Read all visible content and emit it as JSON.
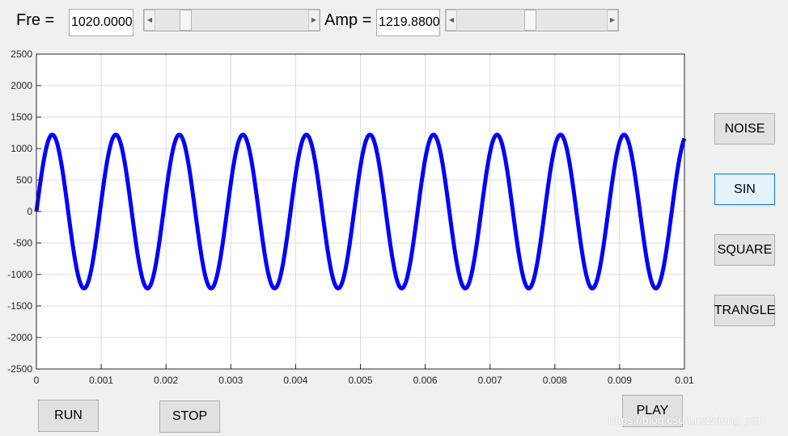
{
  "controls": {
    "fre_label": "Fre =",
    "fre_value": "1020.0000",
    "fre_slider_fraction": 0.17,
    "amp_label": "Amp =",
    "amp_value": "1219.8800",
    "amp_slider_fraction": 0.49
  },
  "buttons": {
    "noise": "NOISE",
    "sin": "SIN",
    "square": "SQUARE",
    "triangle": "TRANGLE",
    "run": "RUN",
    "stop": "STOP",
    "play": "PLAY"
  },
  "watermark": "https://blog.csdn.net/xiong_xin",
  "colors": {
    "line": "#0000ff",
    "grid": "#dcdcdc",
    "axes": "#262626",
    "active_button_border": "#0078d7"
  },
  "chart_data": {
    "type": "line",
    "waveform": "sine",
    "frequency": 1020,
    "amplitude": 1219.88,
    "xlim": [
      0,
      0.01
    ],
    "ylim": [
      -2500,
      2500
    ],
    "x_ticks": [
      "0",
      "0.001",
      "0.002",
      "0.003",
      "0.004",
      "0.005",
      "0.006",
      "0.007",
      "0.008",
      "0.009",
      "0.01"
    ],
    "x_tick_values": [
      0,
      0.001,
      0.002,
      0.003,
      0.004,
      0.005,
      0.006,
      0.007,
      0.008,
      0.009,
      0.01
    ],
    "y_ticks": [
      "2500",
      "2000",
      "1500",
      "1000",
      "500",
      "0",
      "-500",
      "-1000",
      "-1500",
      "-2000",
      "-2500"
    ],
    "y_tick_values": [
      2500,
      2000,
      1500,
      1000,
      500,
      0,
      -500,
      -1000,
      -1500,
      -2000,
      -2500
    ],
    "grid": true
  }
}
